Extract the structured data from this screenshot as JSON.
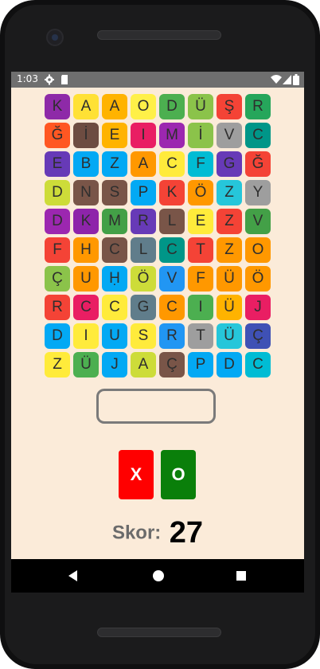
{
  "status": {
    "time": "1:03",
    "icons": [
      "settings-icon",
      "sd-card-icon",
      "wifi-icon",
      "signal-icon",
      "battery-icon"
    ]
  },
  "grid": {
    "rows": [
      [
        {
          "letter": "K",
          "color": "#8e2aa8"
        },
        {
          "letter": "A",
          "color": "#ffe135"
        },
        {
          "letter": "A",
          "color": "#ffb300"
        },
        {
          "letter": "O",
          "color": "#fff048"
        },
        {
          "letter": "D",
          "color": "#4caf50"
        },
        {
          "letter": "Ü",
          "color": "#8bc34a"
        },
        {
          "letter": "Ş",
          "color": "#f44336"
        },
        {
          "letter": "R",
          "color": "#26a65b"
        }
      ],
      [
        {
          "letter": "Ğ",
          "color": "#ff5722"
        },
        {
          "letter": "İ",
          "color": "#6d4c41"
        },
        {
          "letter": "E",
          "color": "#ffb300"
        },
        {
          "letter": "I",
          "color": "#e91e63"
        },
        {
          "letter": "M",
          "color": "#9c27b0"
        },
        {
          "letter": "İ",
          "color": "#8bc34a"
        },
        {
          "letter": "V",
          "color": "#9e9e9e"
        },
        {
          "letter": "C",
          "color": "#009688"
        }
      ],
      [
        {
          "letter": "E",
          "color": "#673ab7"
        },
        {
          "letter": "B",
          "color": "#03a9f4"
        },
        {
          "letter": "Z",
          "color": "#03a9f4"
        },
        {
          "letter": "A",
          "color": "#ff9800"
        },
        {
          "letter": "C",
          "color": "#ffeb3b"
        },
        {
          "letter": "F",
          "color": "#00bcd4"
        },
        {
          "letter": "G",
          "color": "#673ab7"
        },
        {
          "letter": "Ğ",
          "color": "#f44336"
        }
      ],
      [
        {
          "letter": "D",
          "color": "#cddc39"
        },
        {
          "letter": "N",
          "color": "#795548"
        },
        {
          "letter": "S",
          "color": "#795548"
        },
        {
          "letter": "P",
          "color": "#03a9f4"
        },
        {
          "letter": "K",
          "color": "#f44336"
        },
        {
          "letter": "Ö",
          "color": "#ff9800"
        },
        {
          "letter": "Z",
          "color": "#26c6da"
        },
        {
          "letter": "Y",
          "color": "#9e9e9e"
        }
      ],
      [
        {
          "letter": "D",
          "color": "#9c27b0"
        },
        {
          "letter": "K",
          "color": "#8e24aa"
        },
        {
          "letter": "M",
          "color": "#43a047"
        },
        {
          "letter": "R",
          "color": "#673ab7"
        },
        {
          "letter": "L",
          "color": "#795548"
        },
        {
          "letter": "E",
          "color": "#ffeb3b"
        },
        {
          "letter": "Z",
          "color": "#f44336"
        },
        {
          "letter": "V",
          "color": "#43a047"
        }
      ],
      [
        {
          "letter": "F",
          "color": "#f44336"
        },
        {
          "letter": "H",
          "color": "#ff9800"
        },
        {
          "letter": "C",
          "color": "#795548"
        },
        {
          "letter": "L",
          "color": "#607d8b"
        },
        {
          "letter": "C",
          "color": "#009688"
        },
        {
          "letter": "T",
          "color": "#f44336"
        },
        {
          "letter": "Z",
          "color": "#ff9800"
        },
        {
          "letter": "O",
          "color": "#ff9800"
        }
      ],
      [
        {
          "letter": "Ç",
          "color": "#8bc34a"
        },
        {
          "letter": "U",
          "color": "#ff9800"
        },
        {
          "letter": "Ḥ",
          "color": "#03a9f4"
        },
        {
          "letter": "Ö",
          "color": "#cddc39"
        },
        {
          "letter": "V",
          "color": "#2196f3"
        },
        {
          "letter": "F",
          "color": "#ff9800"
        },
        {
          "letter": "Ü",
          "color": "#ff9800"
        },
        {
          "letter": "Ö",
          "color": "#ff9800"
        }
      ],
      [
        {
          "letter": "R",
          "color": "#f44336"
        },
        {
          "letter": "C",
          "color": "#e91e63"
        },
        {
          "letter": "C",
          "color": "#ffeb3b"
        },
        {
          "letter": "G",
          "color": "#607d8b"
        },
        {
          "letter": "C",
          "color": "#ff9800"
        },
        {
          "letter": "I",
          "color": "#4caf50"
        },
        {
          "letter": "Ü",
          "color": "#ffb300"
        },
        {
          "letter": "J",
          "color": "#e91e63"
        }
      ],
      [
        {
          "letter": "D",
          "color": "#03a9f4"
        },
        {
          "letter": "I",
          "color": "#ffeb3b"
        },
        {
          "letter": "U",
          "color": "#03a9f4"
        },
        {
          "letter": "S",
          "color": "#ffeb3b"
        },
        {
          "letter": "R",
          "color": "#2196f3"
        },
        {
          "letter": "T",
          "color": "#9e9e9e"
        },
        {
          "letter": "Ü",
          "color": "#26c6da"
        },
        {
          "letter": "Ç",
          "color": "#3f51b5"
        }
      ],
      [
        {
          "letter": "Z",
          "color": "#ffeb3b"
        },
        {
          "letter": "Ü",
          "color": "#4caf50"
        },
        {
          "letter": "J",
          "color": "#03a9f4"
        },
        {
          "letter": "A",
          "color": "#cddc39"
        },
        {
          "letter": "Ç",
          "color": "#795548"
        },
        {
          "letter": "P",
          "color": "#03a9f4"
        },
        {
          "letter": "D",
          "color": "#03a9f4"
        },
        {
          "letter": "C",
          "color": "#00bcd4"
        }
      ]
    ]
  },
  "answer": {
    "value": ""
  },
  "buttons": {
    "cancel_label": "X",
    "confirm_label": "O"
  },
  "score": {
    "label": "Skor:",
    "value": "27"
  }
}
